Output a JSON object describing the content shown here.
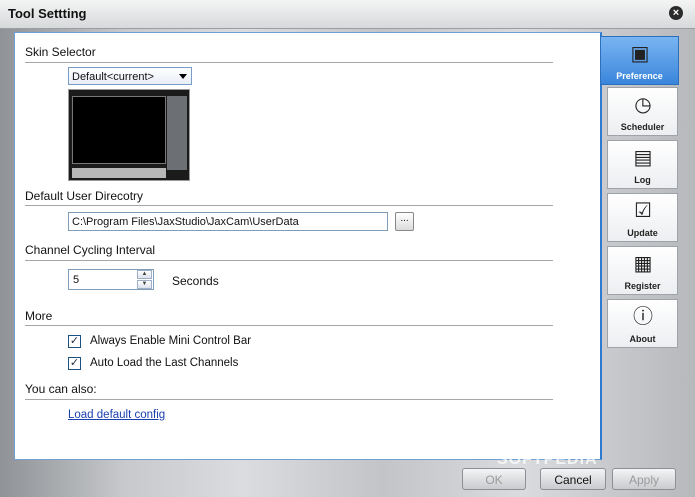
{
  "window": {
    "title": "Tool Settting"
  },
  "skin": {
    "section_title": "Skin Selector",
    "selected": "Default<current>"
  },
  "directory": {
    "section_title": "Default User Direcotry",
    "path": "C:\\Program Files\\JaxStudio\\JaxCam\\UserData",
    "browse_label": "..."
  },
  "cycling": {
    "section_title": "Channel Cycling Interval",
    "value": "5",
    "unit": "Seconds"
  },
  "more": {
    "section_title": "More",
    "options": [
      {
        "label": "Always Enable Mini Control Bar",
        "checked": true
      },
      {
        "label": "Auto Load the Last Channels",
        "checked": true
      }
    ]
  },
  "also": {
    "section_title": "You can also:",
    "link": "Load default config"
  },
  "tabs": [
    {
      "label": "Preference",
      "icon": "folder-icon",
      "active": true
    },
    {
      "label": "Scheduler",
      "icon": "clock-icon",
      "active": false
    },
    {
      "label": "Log",
      "icon": "notebook-icon",
      "active": false
    },
    {
      "label": "Update",
      "icon": "checkbox-window-icon",
      "active": false
    },
    {
      "label": "Register",
      "icon": "user-card-icon",
      "active": false
    },
    {
      "label": "About",
      "icon": "info-icon",
      "active": false
    }
  ],
  "buttons": {
    "ok": "OK",
    "cancel": "Cancel",
    "apply": "Apply"
  },
  "watermark": "SOFTPEDIA"
}
